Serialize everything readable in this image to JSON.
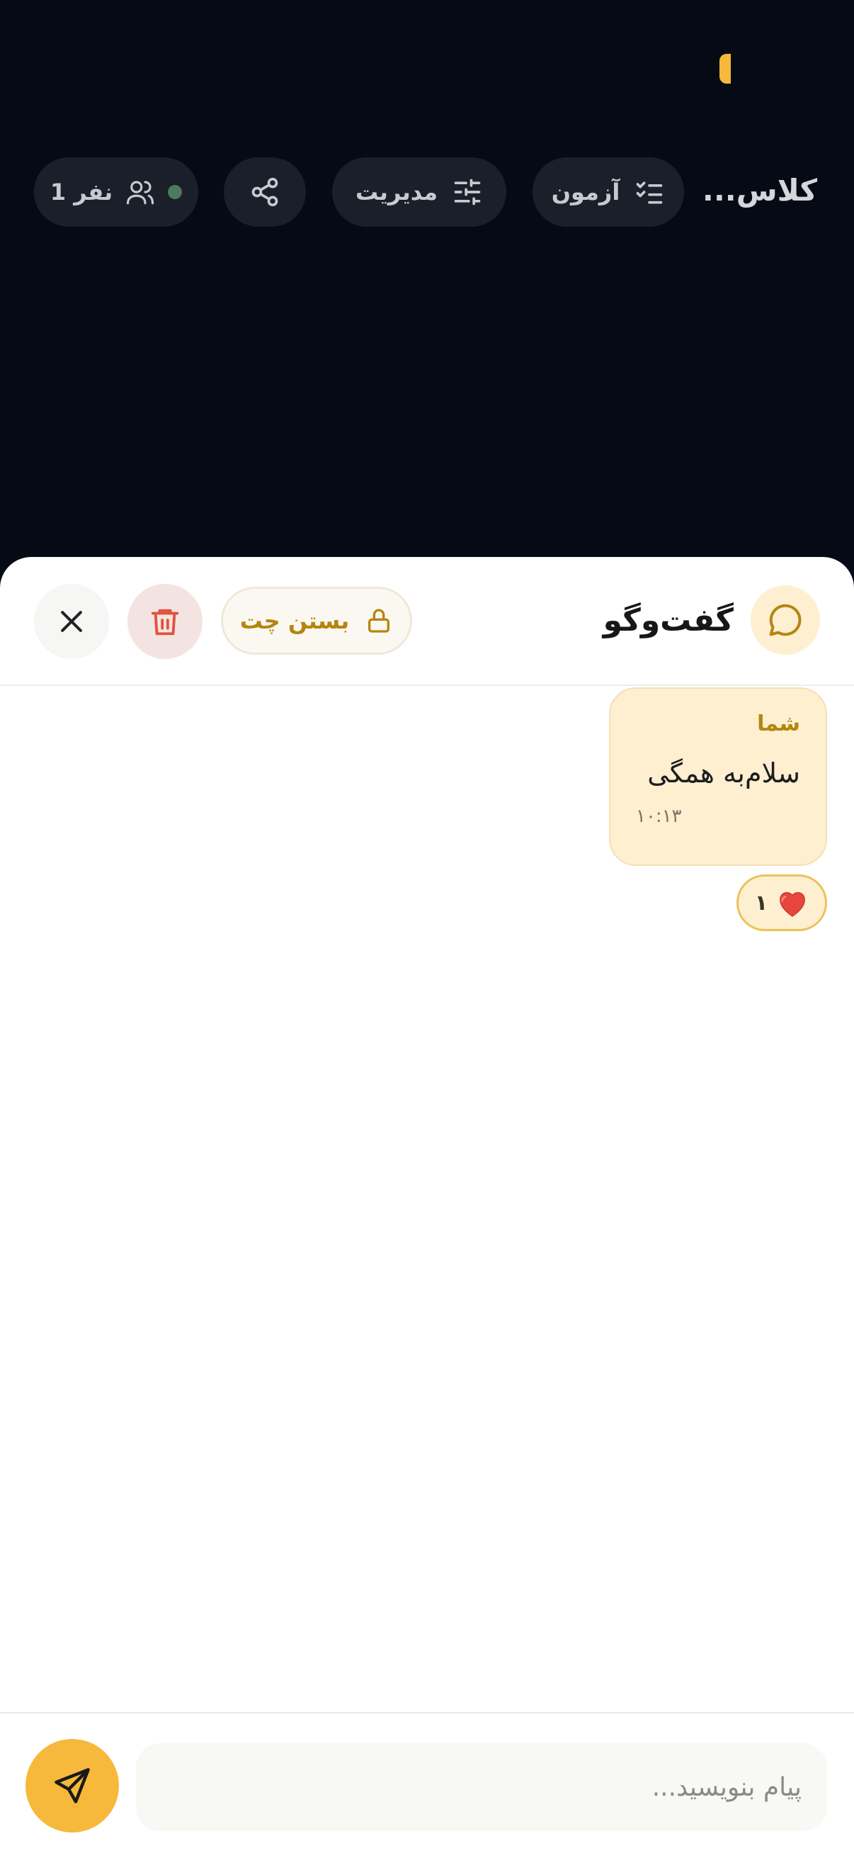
{
  "header": {
    "class_title": "کلاس...",
    "quiz_label": "آزمون",
    "manage_label": "مدیریت",
    "participants_label": "1 نفر"
  },
  "chat": {
    "title": "گفت‌وگو",
    "close_chat_label": "بستن چت"
  },
  "messages": [
    {
      "sender": "شما",
      "text": "سلام‌به همگی",
      "time": "۱۰:۱۳",
      "reaction": {
        "emoji": "❤️",
        "count": "۱"
      }
    }
  ],
  "composer": {
    "placeholder": "پیام بنویسید..."
  },
  "icons": {
    "quiz": "checklist-icon",
    "manage": "sliders-icon",
    "share": "share-icon",
    "participants": "users-icon",
    "chat": "chat-bubble-icon",
    "lock": "lock-icon",
    "trash": "trash-icon",
    "close": "close-icon",
    "send": "send-icon",
    "reaction": "heart-icon"
  },
  "colors": {
    "accent": "#f6b93b",
    "accent_dark": "#b5860f",
    "background_dark": "#060a14",
    "bubble": "#fdefd0",
    "danger": "#e0533e",
    "online": "#4c7a5a"
  }
}
